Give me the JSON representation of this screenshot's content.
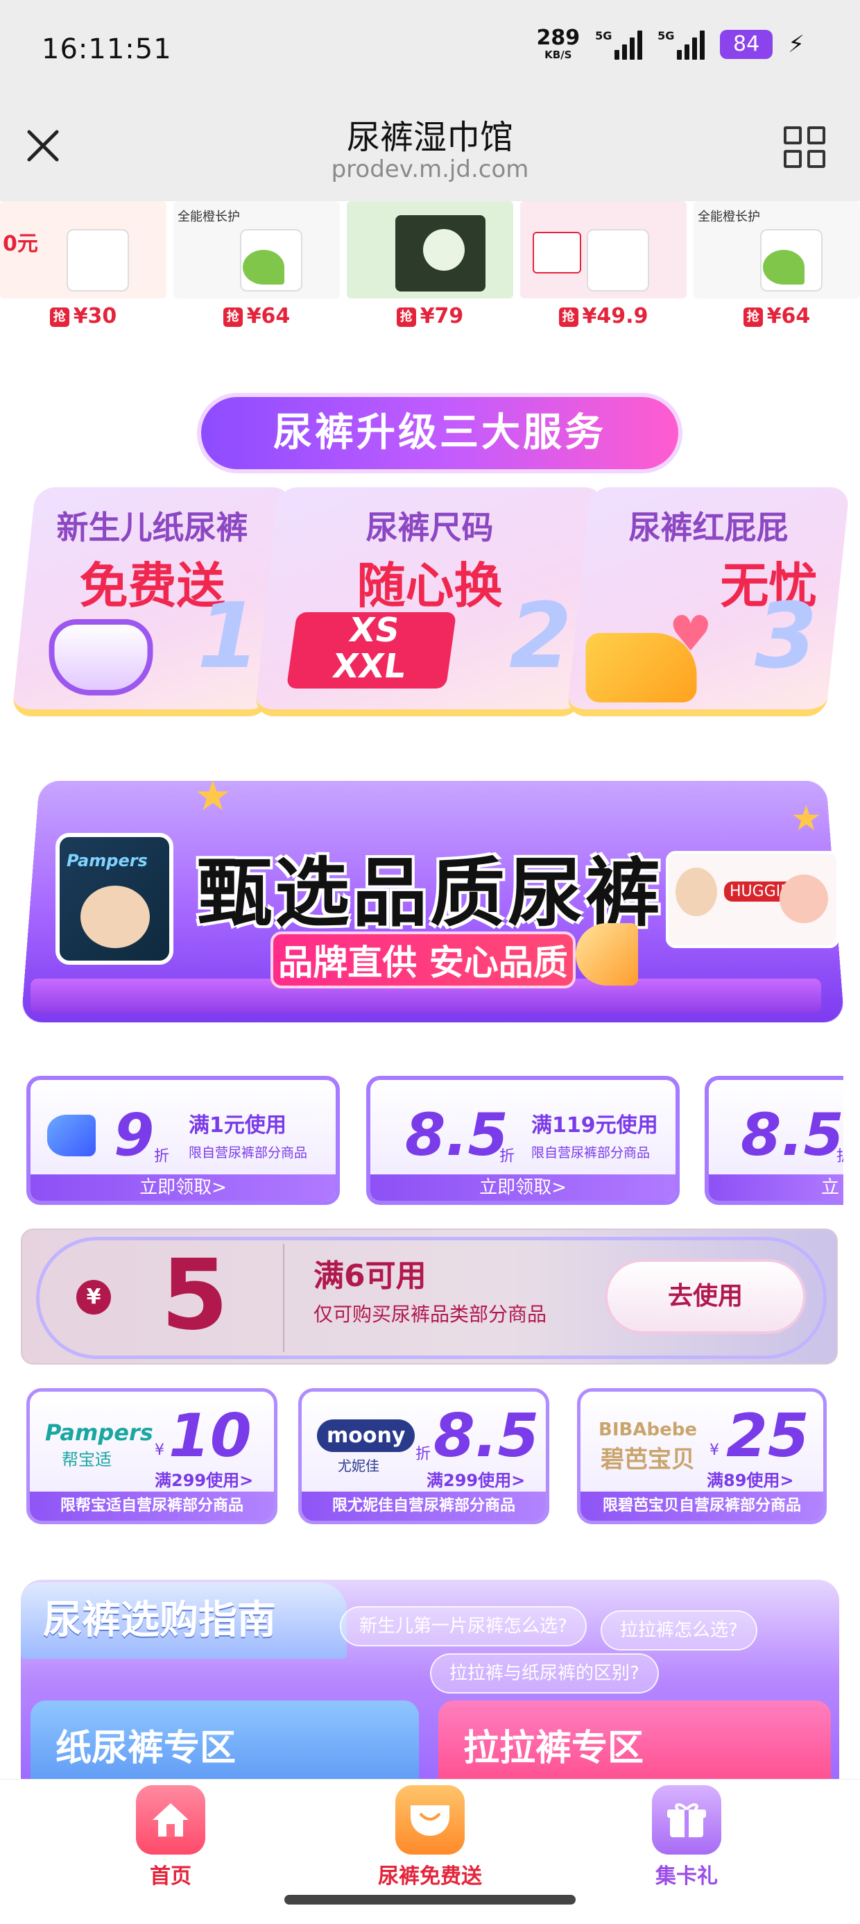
{
  "status_bar": {
    "time": "16:11:51",
    "net_speed": "289",
    "net_unit": "KB/S",
    "sig1_label": "5G",
    "sig2_label": "5G",
    "battery": "84",
    "battery_color": "#8b44ec"
  },
  "header": {
    "title": "尿裤湿巾馆",
    "url": "prodev.m.jd.com",
    "close_icon": "close-icon",
    "menu_icon": "grid-icon"
  },
  "products": [
    {
      "tag": "",
      "price": "¥30",
      "bg": "#fff1ee"
    },
    {
      "tag": "全能橙长护",
      "price": "¥64",
      "bg": "#f7f7f7"
    },
    {
      "tag": "",
      "price": "¥79",
      "bg": "#dff2d9"
    },
    {
      "tag": "",
      "price": "¥49.9",
      "bg": "#fbe9ef"
    },
    {
      "tag": "全能橙长护",
      "price": "¥64",
      "bg": "#f7f7f7"
    }
  ],
  "qiang_label": "抢",
  "services": {
    "title": "尿裤升级三大服务",
    "cards": [
      {
        "line1": "新生儿纸尿裤",
        "line2": "免费送",
        "num": "1"
      },
      {
        "line1": "尿裤尺码",
        "line2": "随心换",
        "num": "2",
        "xs": "XS",
        "xxl": "XXL"
      },
      {
        "line1": "尿裤红屁屁",
        "line2": "无忧",
        "num": "3"
      }
    ]
  },
  "banner": {
    "title": "甄选品质尿裤",
    "subtitle": "品牌直供 安心品质",
    "left_brand": "Pampers",
    "right_brand": "HUGGIES"
  },
  "coupons": [
    {
      "value": "9",
      "unit": "折",
      "condition": "满1元使用",
      "limit": "限自营尿裤部分商品",
      "action": "立即领取>"
    },
    {
      "value": "8.5",
      "unit": "折",
      "condition": "满119元使用",
      "limit": "限自营尿裤部分商品",
      "action": "立即领取>"
    },
    {
      "value": "8.5",
      "unit": "折",
      "condition": "",
      "limit": "",
      "action": "立"
    }
  ],
  "big_coupon": {
    "yen": "¥",
    "amount": "5",
    "condition": "满6可用",
    "limit": "仅可购买尿裤品类部分商品",
    "button": "去使用"
  },
  "brand_coupons": [
    {
      "brand": "Pampers",
      "brand_cn": "帮宝适",
      "prefix": "¥",
      "value": "10",
      "condition": "满299使用>",
      "limit": "限帮宝适自营尿裤部分商品"
    },
    {
      "brand": "moony",
      "brand_cn": "尤妮佳",
      "prefix": "折",
      "value": "8.5",
      "condition": "满299使用>",
      "limit": "限尤妮佳自营尿裤部分商品"
    },
    {
      "brand": "BIBAbebe",
      "brand_cn": "碧芭宝贝",
      "prefix": "¥",
      "value": "25",
      "condition": "满89使用>",
      "limit": "限碧芭宝贝自营尿裤部分商品"
    }
  ],
  "guide": {
    "title": "尿裤选购指南",
    "questions": [
      "新生儿第一片尿裤怎么选?",
      "拉拉裤怎么选?",
      "拉拉裤与纸尿裤的区别?"
    ],
    "zones": [
      "纸尿裤专区",
      "拉拉裤专区"
    ]
  },
  "tabbar": {
    "tabs": [
      {
        "label": "首页",
        "color": "#e4243b"
      },
      {
        "label": "尿裤免费送",
        "color": "#e4243b"
      },
      {
        "label": "集卡礼",
        "color": "#9b4de8"
      }
    ]
  }
}
